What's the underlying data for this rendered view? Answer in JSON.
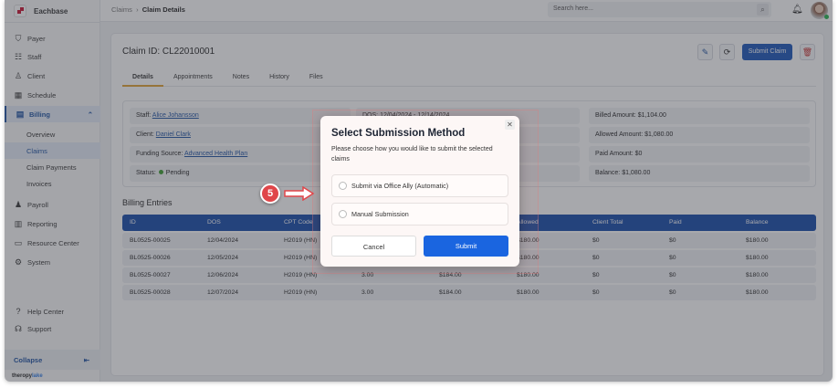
{
  "app": {
    "name": "Eachbase",
    "footer_brand_a": "theropy",
    "footer_brand_b": "lake"
  },
  "sidebar": {
    "items": [
      {
        "label": "Payer",
        "icon": "shield-icon",
        "glyph": "⛉"
      },
      {
        "label": "Staff",
        "icon": "staff-icon",
        "glyph": "☷"
      },
      {
        "label": "Client",
        "icon": "client-icon",
        "glyph": "♙"
      },
      {
        "label": "Schedule",
        "icon": "calendar-icon",
        "glyph": "▦"
      },
      {
        "label": "Billing",
        "icon": "billing-icon",
        "glyph": "▤"
      },
      {
        "label": "Overview"
      },
      {
        "label": "Claims"
      },
      {
        "label": "Claim Payments"
      },
      {
        "label": "Invoices"
      },
      {
        "label": "Payroll",
        "icon": "payroll-icon",
        "glyph": "♟"
      },
      {
        "label": "Reporting",
        "icon": "reporting-icon",
        "glyph": "▥"
      },
      {
        "label": "Resource Center",
        "icon": "folder-icon",
        "glyph": "▭"
      },
      {
        "label": "System",
        "icon": "gear-icon",
        "glyph": "⚙"
      },
      {
        "label": "Help Center",
        "icon": "help-icon",
        "glyph": "?"
      },
      {
        "label": "Support",
        "icon": "headset-icon",
        "glyph": "☊"
      }
    ],
    "collapse": "Collapse"
  },
  "header": {
    "breadcrumb": [
      "Claims",
      "Claim Details"
    ],
    "search_placeholder": "Search here..."
  },
  "claim": {
    "title": "Claim ID: CL22010001",
    "submit_label": "Submit Claim",
    "tabs": [
      "Details",
      "Appointments",
      "Notes",
      "History",
      "Files"
    ],
    "info": {
      "staff_label": "Staff:",
      "staff": "Alice Johansson",
      "client_label": "Client:",
      "client": "Daniel Clark",
      "funding_label": "Funding Source:",
      "funding": "Advanced Health Plan",
      "status_label": "Status:",
      "status": "Pending",
      "status_color": "#3a9b2c",
      "dos_label": "DOS:",
      "dos": "12/04/2024 - 12/14/2024",
      "billed_label": "Billed Amount:",
      "billed": "$1,104.00",
      "allowed_label": "Allowed Amount:",
      "allowed": "$1,080.00",
      "paid_label": "Paid Amount:",
      "paid": "$0",
      "balance_label": "Balance:",
      "balance": "$1,080.00"
    }
  },
  "billing": {
    "title": "Billing Entries",
    "headers": [
      "ID",
      "DOS",
      "CPT Code",
      "",
      "",
      "Allowed",
      "Client Total",
      "Paid",
      "Balance"
    ],
    "rows": [
      [
        "BL0525-00025",
        "12/04/2024",
        "H2019 (HN)",
        "",
        "",
        "$180.00",
        "$0",
        "$0",
        "$180.00"
      ],
      [
        "BL0525-00026",
        "12/05/2024",
        "H2019 (HN)",
        "",
        "",
        "$180.00",
        "$0",
        "$0",
        "$180.00"
      ],
      [
        "BL0525-00027",
        "12/06/2024",
        "H2019 (HN)",
        "3.00",
        "$184.00",
        "$180.00",
        "$0",
        "$0",
        "$180.00"
      ],
      [
        "BL0525-00028",
        "12/07/2024",
        "H2019 (HN)",
        "3.00",
        "$184.00",
        "$180.00",
        "$0",
        "$0",
        "$180.00"
      ]
    ]
  },
  "modal": {
    "title": "Select Submission Method",
    "description": "Please choose how you would like to submit the selected claims",
    "options": [
      "Submit via Office Ally (Automatic)",
      "Manual Submission"
    ],
    "cancel": "Cancel",
    "submit": "Submit"
  },
  "step_marker": "5"
}
